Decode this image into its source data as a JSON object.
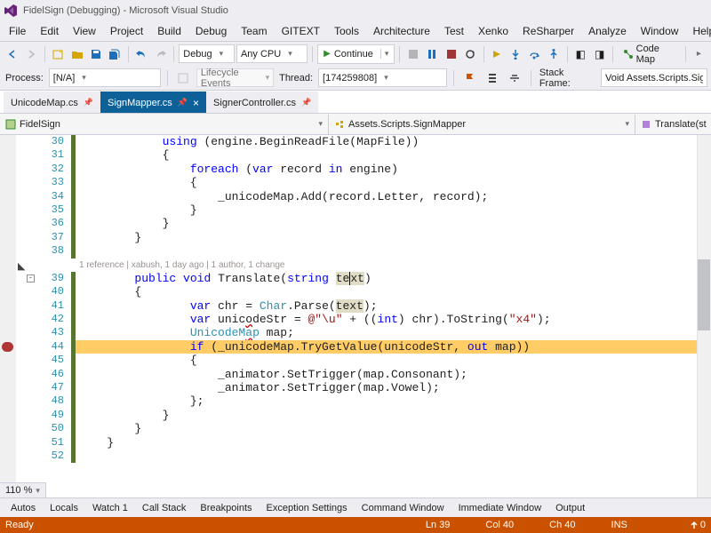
{
  "window": {
    "title": "FidelSign (Debugging) - Microsoft Visual Studio"
  },
  "menu": [
    "File",
    "Edit",
    "View",
    "Project",
    "Build",
    "Debug",
    "Team",
    "GITEXT",
    "Tools",
    "Architecture",
    "Test",
    "Xenko",
    "ReSharper",
    "Analyze",
    "Window",
    "Help"
  ],
  "toolbar1": {
    "solution_config": "Debug",
    "platform": "Any CPU",
    "continue": "Continue",
    "codemap": "Code Map"
  },
  "toolbar2": {
    "process_label": "Process:",
    "process_value": "[N/A]",
    "lifecycle": "Lifecycle Events",
    "thread_label": "Thread:",
    "thread_value": "[174259808]",
    "stackframe_label": "Stack Frame:",
    "stackframe_value": "Void Assets.Scripts.SignMapper.Tra"
  },
  "tabs": [
    {
      "name": "UnicodeMap.cs",
      "active": false,
      "pinned": true
    },
    {
      "name": "SignMapper.cs",
      "active": true,
      "pinned": true,
      "dirty": true
    },
    {
      "name": "SignerController.cs",
      "active": false,
      "pinned": true
    }
  ],
  "nav": {
    "left": "FidelSign",
    "mid": "Assets.Scripts.SignMapper",
    "right": "Translate(st"
  },
  "codelens": "1 reference | xabush, 1 day ago | 1 author, 1 change",
  "lines": [
    {
      "n": 30,
      "ch": "saved",
      "html": "            <span class='kw'>using</span> (engine.BeginReadFile(MapFile))"
    },
    {
      "n": 31,
      "ch": "saved",
      "html": "            {"
    },
    {
      "n": 32,
      "ch": "saved",
      "html": "                <span class='kw'>foreach</span> (<span class='kw'>var</span> record <span class='kw'>in</span> engine)"
    },
    {
      "n": 33,
      "ch": "saved",
      "html": "                {"
    },
    {
      "n": 34,
      "ch": "saved",
      "html": "                    _unicodeMap.Add(record.Letter, record);"
    },
    {
      "n": 35,
      "ch": "saved",
      "html": "                }"
    },
    {
      "n": 36,
      "ch": "saved",
      "html": "            }"
    },
    {
      "n": 37,
      "ch": "saved",
      "html": "        }"
    },
    {
      "n": 38,
      "ch": "saved",
      "html": ""
    },
    {
      "n": "codelens"
    },
    {
      "n": 39,
      "ch": "saved",
      "outline": true,
      "html": "        <span class='kw'>public</span> <span class='kw'>void</span> Translate(<span class='kw'>string</span> <span class='highlight-word'>te<span style='border-left:1px solid #000'>x</span>t</span>)"
    },
    {
      "n": 40,
      "ch": "saved",
      "html": "        {"
    },
    {
      "n": 41,
      "ch": "saved",
      "html": "                <span class='kw'>var</span> chr = <span class='typ'>Char</span>.Parse(<span class='highlight-word'>text</span>);"
    },
    {
      "n": 42,
      "ch": "saved",
      "html": "                <span class='kw'>var</span> unic<span style='text-decoration:underline wavy #cc0000'>o</span>deStr = <span class='str'>@\"\\u\"</span> + ((<span class='kw'>int</span>) chr).ToString(<span class='str'>\"x4\"</span>);"
    },
    {
      "n": 43,
      "ch": "saved",
      "html": "                <span class='typ'>UnicodeM<span style='text-decoration:underline wavy #cc0000'>a</span>p</span> map;"
    },
    {
      "n": 44,
      "ch": "saved",
      "bp": true,
      "hl": true,
      "html": "                <span class='kw'>if</span> (_unicodeMap.TryGetValue(unicodeStr, <span class='kw'>out</span> map))"
    },
    {
      "n": 45,
      "ch": "saved",
      "html": "                {"
    },
    {
      "n": 46,
      "ch": "saved",
      "html": "                    _animator.SetTrigger(map.Consonant);"
    },
    {
      "n": 47,
      "ch": "saved",
      "html": "                    _animator.SetTrigger(map.Vowel);"
    },
    {
      "n": 48,
      "ch": "saved",
      "html": "                };"
    },
    {
      "n": 49,
      "ch": "saved",
      "html": "            }"
    },
    {
      "n": 50,
      "ch": "saved",
      "html": "        }"
    },
    {
      "n": 51,
      "ch": "saved",
      "html": "    }"
    },
    {
      "n": 52,
      "ch": "saved",
      "html": ""
    }
  ],
  "zoom": "110 %",
  "bottom_tabs": [
    "Autos",
    "Locals",
    "Watch 1",
    "Call Stack",
    "Breakpoints",
    "Exception Settings",
    "Command Window",
    "Immediate Window",
    "Output"
  ],
  "status": {
    "left": "Ready",
    "ln": "Ln 39",
    "col": "Col 40",
    "ch": "Ch 40",
    "ins": "INS",
    "publish": "0"
  }
}
